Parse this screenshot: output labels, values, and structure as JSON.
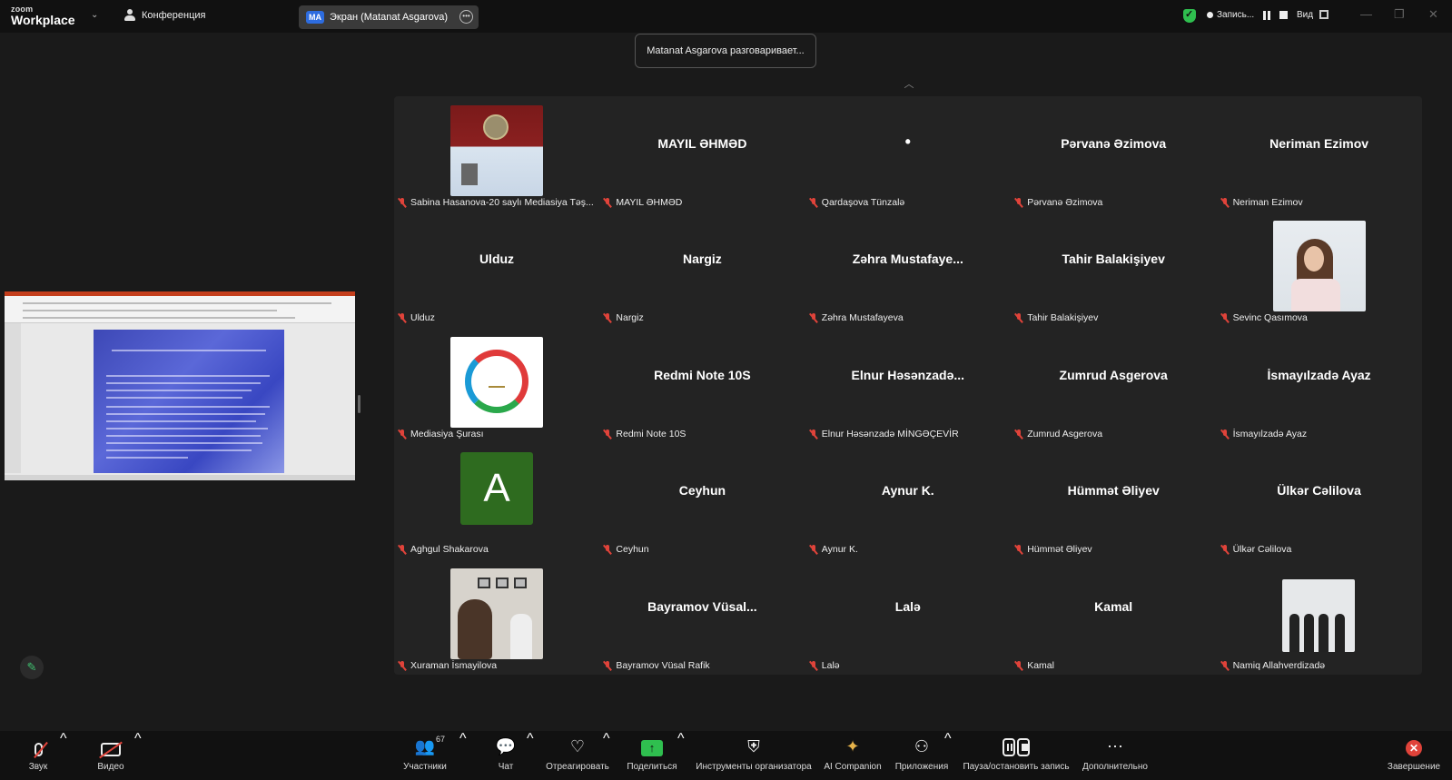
{
  "topbar": {
    "logo_small": "zoom",
    "logo_big": "Workplace",
    "conference_label": "Конференция",
    "screen_tab_badge": "MA",
    "screen_tab_label": "Экран (Matanat Asgarova)",
    "record_label": "Запись...",
    "view_label": "Вид"
  },
  "speaking_indicator": "Matanat Asgarova разговаривает...",
  "gallery": {
    "tiles": [
      {
        "display": "",
        "nameplate": "Sabina Hasanova-20 saylı Mediasiya Təş...",
        "media": "certificate-photo"
      },
      {
        "display": "MAYIL ƏHMƏD",
        "nameplate": "MAYIL ƏHMƏD"
      },
      {
        "display": "•",
        "nameplate": "Qardaşova Tünzalə"
      },
      {
        "display": "Pərvanə Əzimova",
        "nameplate": "Pərvanə Əzimova"
      },
      {
        "display": "Neriman Ezimov",
        "nameplate": "Neriman Ezimov"
      },
      {
        "display": "Ulduz",
        "nameplate": "Ulduz"
      },
      {
        "display": "Nargiz",
        "nameplate": "Nargiz"
      },
      {
        "display": "Zəhra  Mustafaye...",
        "nameplate": "Zəhra Mustafayeva"
      },
      {
        "display": "Tahir Balakişiyev",
        "nameplate": "Tahir Balakişiyev"
      },
      {
        "display": "",
        "nameplate": "Sevinc Qasımova",
        "media": "woman-photo"
      },
      {
        "display": "",
        "nameplate": "Mediasiya Şurası",
        "media": "mediation-logo"
      },
      {
        "display": "Redmi Note 10S",
        "nameplate": "Redmi Note 10S"
      },
      {
        "display": "Elnur  Həsənzadə...",
        "nameplate": "Elnur Həsənzadə MİNGƏÇEVİR"
      },
      {
        "display": "Zumrud Asgerova",
        "nameplate": "Zumrud Asgerova"
      },
      {
        "display": "İsmayılzadə Ayaz",
        "nameplate": "İsmayılzadə Ayaz"
      },
      {
        "display": "A",
        "nameplate": "Aghgul Shakarova",
        "media": "letter-avatar"
      },
      {
        "display": "Ceyhun",
        "nameplate": "Ceyhun"
      },
      {
        "display": "Aynur K.",
        "nameplate": "Aynur K."
      },
      {
        "display": "Hümmət Əliyev",
        "nameplate": "Hümmət Əliyev"
      },
      {
        "display": "Ülkər Cəlilova",
        "nameplate": "Ülkər Cəlilova"
      },
      {
        "display": "",
        "nameplate": "Xuraman İsmayilova",
        "media": "room-photo"
      },
      {
        "display": "Bayramov  Vüsal...",
        "nameplate": "Bayramov Vüsal Rafik"
      },
      {
        "display": "Lalə",
        "nameplate": "Lalə"
      },
      {
        "display": "Kamal",
        "nameplate": "Kamal"
      },
      {
        "display": "",
        "nameplate": "Namiq Allahverdizadə",
        "media": "group-photo"
      }
    ]
  },
  "toolbar": {
    "audio": "Звук",
    "video": "Видео",
    "participants": "Участники",
    "participants_count": "67",
    "chat": "Чат",
    "react": "Отреагировать",
    "share": "Поделиться",
    "host_tools": "Инструменты организатора",
    "ai_companion": "AI Companion",
    "apps": "Приложения",
    "pause_stop_recording": "Пауза/остановить запись",
    "more": "Дополнительно",
    "end": "Завершение"
  },
  "colors": {
    "background": "#1a1a1a",
    "gallery": "#232323",
    "muted_red": "#e0433a",
    "share_green": "#2fbf4f",
    "avatar_green": "#2e6b1f"
  }
}
